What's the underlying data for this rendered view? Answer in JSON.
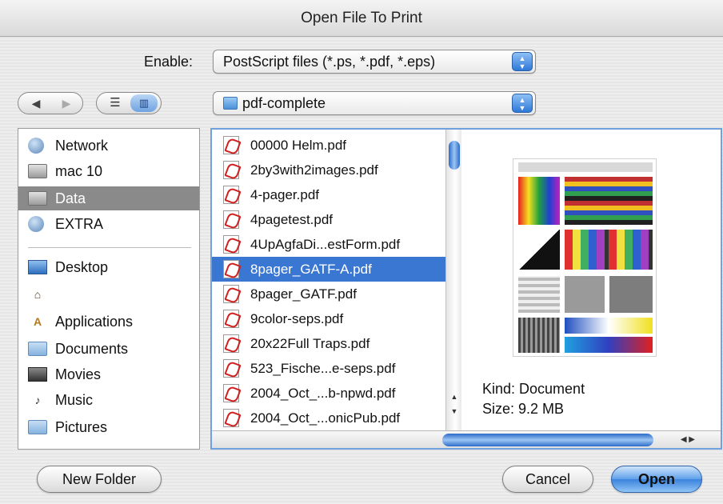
{
  "dialog": {
    "title": "Open File To Print"
  },
  "enable": {
    "label": "Enable:",
    "value": "PostScript files (*.ps, *.pdf, *.eps)"
  },
  "nav": {
    "back_glyph": "◀",
    "forward_glyph": "▶",
    "list_glyph": "☰",
    "column_glyph": "▥"
  },
  "location": {
    "value": "pdf-complete",
    "icon": "folder-icon"
  },
  "sidebar": {
    "devices": [
      {
        "label": "Network",
        "icon": "network-icon"
      },
      {
        "label": "mac 10",
        "icon": "disk-icon"
      },
      {
        "label": "Data",
        "icon": "disk-icon",
        "selected": true
      },
      {
        "label": "EXTRA",
        "icon": "network-disk-icon"
      }
    ],
    "places": [
      {
        "label": "Desktop",
        "icon": "desktop-icon"
      },
      {
        "label": "",
        "icon": "home-icon"
      },
      {
        "label": "Applications",
        "icon": "applications-icon"
      },
      {
        "label": "Documents",
        "icon": "documents-icon"
      },
      {
        "label": "Movies",
        "icon": "movies-icon"
      },
      {
        "label": "Music",
        "icon": "music-icon"
      },
      {
        "label": "Pictures",
        "icon": "pictures-icon"
      }
    ]
  },
  "files": [
    {
      "name": "00000 Helm.pdf"
    },
    {
      "name": "2by3with2images.pdf"
    },
    {
      "name": "4-pager.pdf"
    },
    {
      "name": "4pagetest.pdf"
    },
    {
      "name": "4UpAgfaDi...estForm.pdf"
    },
    {
      "name": "8pager_GATF-A.pdf",
      "selected": true
    },
    {
      "name": "8pager_GATF.pdf"
    },
    {
      "name": "9color-seps.pdf"
    },
    {
      "name": "20x22Full Traps.pdf"
    },
    {
      "name": "523_Fische...e-seps.pdf"
    },
    {
      "name": "2004_Oct_...b-npwd.pdf"
    },
    {
      "name": "2004_Oct_...onicPub.pdf"
    }
  ],
  "preview": {
    "kind": "Kind: Document",
    "size": "Size: 9.2 MB"
  },
  "buttons": {
    "new_folder": "New Folder",
    "cancel": "Cancel",
    "open": "Open"
  },
  "colors": {
    "selection": "#3a77d2",
    "accent": "#5ea0ea",
    "sidebar_selection": "#8a8a8a"
  }
}
